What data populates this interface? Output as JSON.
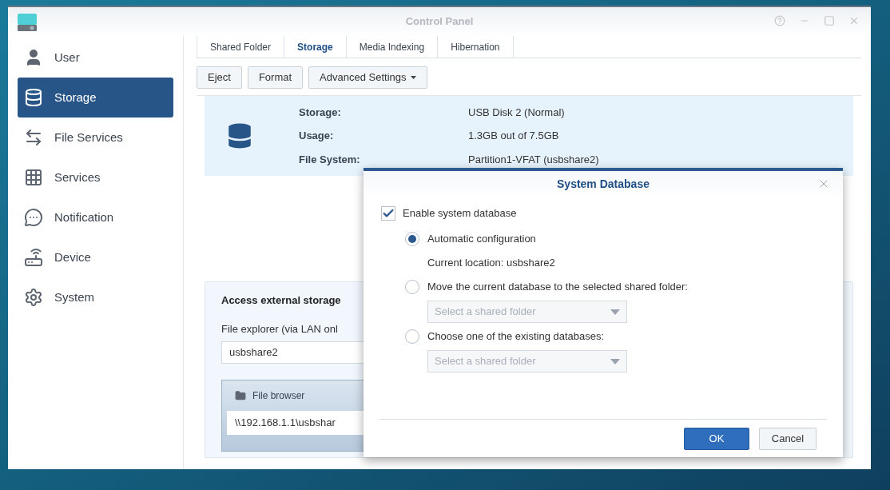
{
  "window": {
    "title": "Control Panel"
  },
  "sidebar": {
    "items": [
      {
        "label": "User",
        "selected": false
      },
      {
        "label": "Storage",
        "selected": true
      },
      {
        "label": "File Services",
        "selected": false
      },
      {
        "label": "Services",
        "selected": false
      },
      {
        "label": "Notification",
        "selected": false
      },
      {
        "label": "Device",
        "selected": false
      },
      {
        "label": "System",
        "selected": false
      }
    ]
  },
  "tabs": [
    {
      "label": "Shared Folder",
      "selected": false
    },
    {
      "label": "Storage",
      "selected": true
    },
    {
      "label": "Media Indexing",
      "selected": false
    },
    {
      "label": "Hibernation",
      "selected": false
    }
  ],
  "toolbar": [
    {
      "label": "Eject",
      "kind": "button"
    },
    {
      "label": "Format",
      "kind": "button"
    },
    {
      "label": "Advanced Settings",
      "kind": "menu"
    }
  ],
  "storage_info": [
    {
      "label": "Storage:",
      "value": "USB Disk 2 (Normal)"
    },
    {
      "label": "Usage:",
      "value": "1.3GB out of 7.5GB"
    },
    {
      "label": "File System:",
      "value": "Partition1-VFAT (usbshare2)"
    }
  ],
  "access_panel": {
    "title": "Access external storage",
    "field_label": "File explorer (via LAN onl",
    "field_value": "usbshare2",
    "browser_title": "File browser",
    "path": "\\\\192.168.1.1\\usbshar"
  },
  "dialog": {
    "title": "System Database",
    "enable": {
      "label": "Enable system database",
      "checked": true
    },
    "options": [
      {
        "kind": "radio",
        "label": "Automatic configuration",
        "selected": true
      },
      {
        "kind": "note",
        "label": "Current location: usbshare2"
      },
      {
        "kind": "radio",
        "label": "Move the current database to the selected shared folder:",
        "selected": false
      },
      {
        "kind": "select",
        "placeholder": "Select a shared folder"
      },
      {
        "kind": "radio",
        "label": "Choose one of the existing databases:",
        "selected": false
      },
      {
        "kind": "select",
        "placeholder": "Select a shared folder"
      }
    ],
    "buttons": [
      {
        "label": "OK",
        "kind": "primary"
      },
      {
        "label": "Cancel",
        "kind": "secondary"
      }
    ]
  }
}
